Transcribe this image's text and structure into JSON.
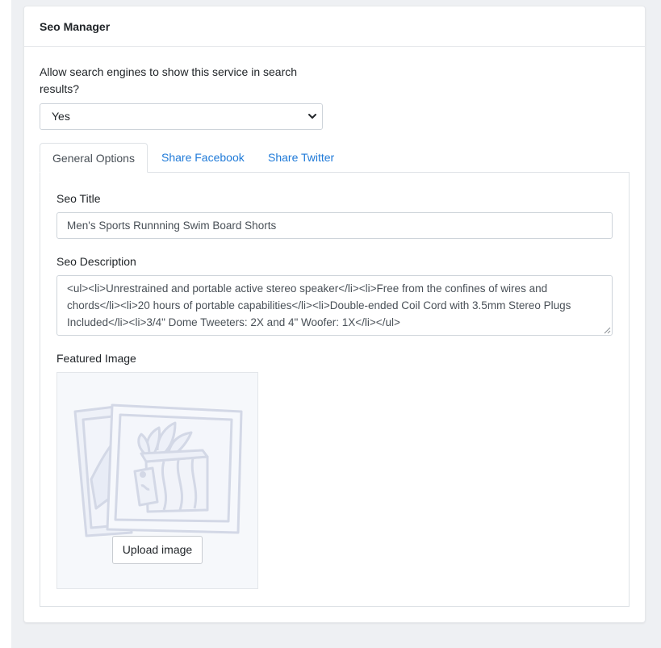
{
  "card": {
    "title": "Seo Manager"
  },
  "visibility": {
    "question": "Allow search engines to show this service in search results?",
    "selected": "Yes"
  },
  "tabs": [
    {
      "label": "General Options",
      "active": true
    },
    {
      "label": "Share Facebook",
      "active": false
    },
    {
      "label": "Share Twitter",
      "active": false
    }
  ],
  "general": {
    "seo_title_label": "Seo Title",
    "seo_title_value": "Men's Sports Runnning Swim Board Shorts",
    "seo_description_label": "Seo Description",
    "seo_description_value": "<ul><li>Unrestrained and portable active stereo speaker</li><li>Free from the confines of wires and chords</li><li>20 hours of portable capabilities</li><li>Double-ended Coil Cord with 3.5mm Stereo Plugs Included</li><li>3/4\" Dome Tweeters: 2X and 4\" Woofer: 1X</li></ul>",
    "featured_image_label": "Featured Image",
    "upload_button": "Upload image"
  },
  "icons": {
    "select_arrow": "chevron-down-icon",
    "image_placeholder": "photo-placeholder-icon",
    "resize": "resize-grip-icon"
  },
  "colors": {
    "link": "#1f7ad8",
    "border": "#dee2e6",
    "page_bg": "#eef0f3",
    "placeholder_stroke": "#d5d9e6"
  }
}
